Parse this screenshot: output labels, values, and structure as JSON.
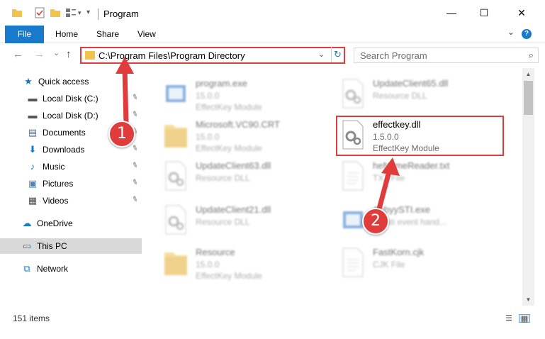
{
  "window": {
    "title": "Program",
    "minimize": "—",
    "maximize": "☐",
    "close": "✕"
  },
  "ribbon": {
    "file": "File",
    "home": "Home",
    "share": "Share",
    "view": "View",
    "expand": "⌄",
    "help": "?"
  },
  "nav": {
    "back": "←",
    "forward": "→",
    "recent": "⌄",
    "up": "↑",
    "address": "C:\\Program Files\\Program Directory",
    "refresh": "↻",
    "dropdown": "⌄",
    "search_placeholder": "Search Program",
    "search_icon": "⌕"
  },
  "sidebar": {
    "items": [
      {
        "label": "Quick access",
        "icon": "star-icon",
        "glyph": "★",
        "color": "#1979ca",
        "pinned": false
      },
      {
        "label": "Local Disk (C:)",
        "icon": "drive-icon",
        "glyph": "▬",
        "color": "#555555",
        "pinned": true
      },
      {
        "label": "Local Disk (D:)",
        "icon": "drive-icon",
        "glyph": "▬",
        "color": "#555555",
        "pinned": true
      },
      {
        "label": "Documents",
        "icon": "documents-icon",
        "glyph": "▤",
        "color": "#5b6b7f",
        "pinned": true
      },
      {
        "label": "Downloads",
        "icon": "download-icon",
        "glyph": "⬇",
        "color": "#1979ca",
        "pinned": true
      },
      {
        "label": "Music",
        "icon": "music-icon",
        "glyph": "♪",
        "color": "#1979ca",
        "pinned": true
      },
      {
        "label": "Pictures",
        "icon": "pictures-icon",
        "glyph": "▣",
        "color": "#4f7fb8",
        "pinned": true
      },
      {
        "label": "Videos",
        "icon": "videos-icon",
        "glyph": "▦",
        "color": "#4a4a4a",
        "pinned": true
      },
      {
        "label": "OneDrive",
        "icon": "cloud-icon",
        "glyph": "☁",
        "color": "#1979ca",
        "pinned": false
      },
      {
        "label": "This PC",
        "icon": "computer-icon",
        "glyph": "▭",
        "color": "#1979ca",
        "pinned": false
      },
      {
        "label": "Network",
        "icon": "network-icon",
        "glyph": "⧉",
        "color": "#1979ca",
        "pinned": false
      }
    ],
    "pin_glyph": "📌"
  },
  "files": [
    {
      "name": "program.exe",
      "version": "15.0.0",
      "type": "EffectKey Module",
      "kind": "exe"
    },
    {
      "name": "UpdateClient65.dll",
      "version": "",
      "type": "Resource DLL",
      "kind": "dll"
    },
    {
      "name": "Microsoft.VC90.CRT",
      "version": "15.0.0",
      "type": "EffectKey Module",
      "kind": "folder"
    },
    {
      "name": "effectkey.dll",
      "version": "1.5.0.0",
      "type": "EffectKey Module",
      "kind": "dll"
    },
    {
      "name": "UpdateClient63.dll",
      "version": "",
      "type": "Resource DLL",
      "kind": "dll"
    },
    {
      "name": "heNameReader.txt",
      "version": "",
      "type": "TXT File",
      "kind": "txt"
    },
    {
      "name": "UpdateClient21.dll",
      "version": "",
      "type": "Resource DLL",
      "kind": "dll"
    },
    {
      "name": "AbbyySTI.exe",
      "version": "",
      "type": "YY sti event hand...",
      "kind": "exe"
    },
    {
      "name": "Resource",
      "version": "15.0.0",
      "type": "EffectKey Module",
      "kind": "folder"
    },
    {
      "name": "FastKorn.cjk",
      "version": "",
      "type": "CJK File",
      "kind": "txt"
    }
  ],
  "status": {
    "count": "151 items"
  },
  "callouts": {
    "one": "1",
    "two": "2"
  },
  "colors": {
    "accent": "#1979ca",
    "annotation_red": "#e03c3c",
    "folder_yellow": "#f1c34a"
  }
}
